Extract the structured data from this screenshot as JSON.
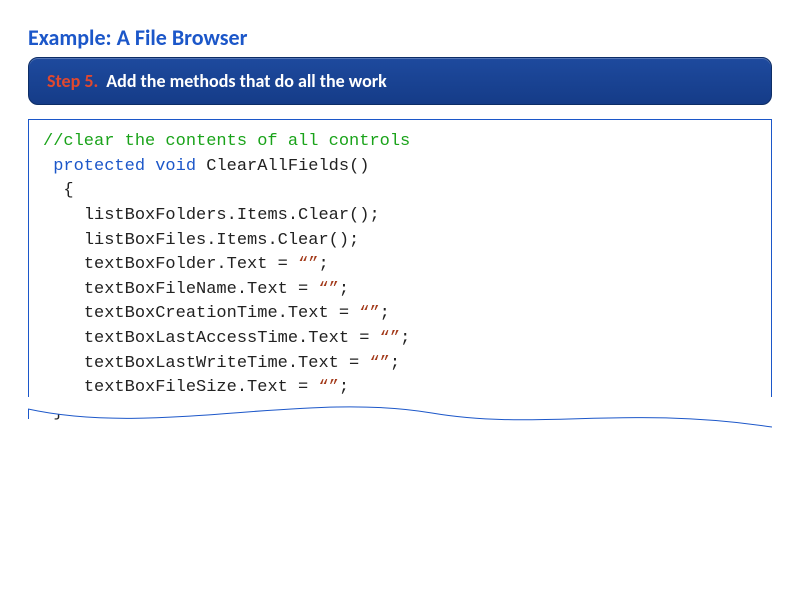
{
  "title": "Example: A File Browser",
  "step": {
    "label": "Step 5.",
    "description": "Add the methods that do all the work"
  },
  "code": {
    "comment": "//clear the contents of all controls",
    "kw_protected": "protected",
    "kw_void": "void",
    "method_name": "ClearAllFields()",
    "brace_open": "{",
    "l1": "listBoxFolders.Items.Clear();",
    "l2": "listBoxFiles.Items.Clear();",
    "l3a": "textBoxFolder.Text = ",
    "l4a": "textBoxFileName.Text = ",
    "l5a": "textBoxCreationTime.Text = ",
    "l6a": "textBoxLastAccessTime.Text = ",
    "l7a": "textBoxLastWriteTime.Text = ",
    "l8a": "textBoxFileSize.Text = ",
    "str": "“”",
    "semi": ";",
    "brace_close": "}"
  }
}
